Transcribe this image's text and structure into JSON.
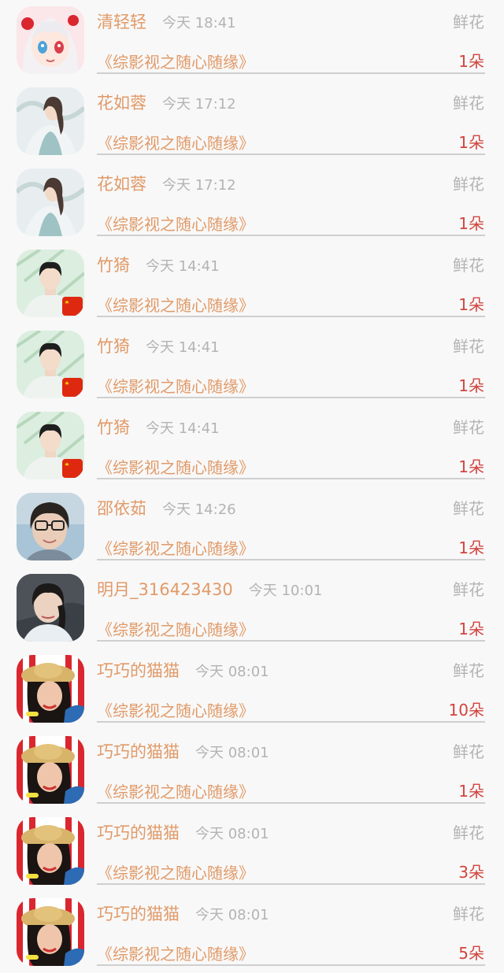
{
  "rows": [
    {
      "name": "清轻轻",
      "time": "今天 18:41",
      "gift": "鲜花",
      "book": "《综影视之随心随缘》",
      "count": "1朵",
      "avatar": "anime-girl"
    },
    {
      "name": "花如蓉",
      "time": "今天 17:12",
      "gift": "鲜花",
      "book": "《综影视之随心随缘》",
      "count": "1朵",
      "avatar": "hanfu-girl"
    },
    {
      "name": "花如蓉",
      "time": "今天 17:12",
      "gift": "鲜花",
      "book": "《综影视之随心随缘》",
      "count": "1朵",
      "avatar": "hanfu-girl"
    },
    {
      "name": "竹猗",
      "time": "今天 14:41",
      "gift": "鲜花",
      "book": "《综影视之随心随缘》",
      "count": "1朵",
      "avatar": "young-man-flag"
    },
    {
      "name": "竹猗",
      "time": "今天 14:41",
      "gift": "鲜花",
      "book": "《综影视之随心随缘》",
      "count": "1朵",
      "avatar": "young-man-flag"
    },
    {
      "name": "竹猗",
      "time": "今天 14:41",
      "gift": "鲜花",
      "book": "《综影视之随心随缘》",
      "count": "1朵",
      "avatar": "young-man-flag"
    },
    {
      "name": "邵依茹",
      "time": "今天 14:26",
      "gift": "鲜花",
      "book": "《综影视之随心随缘》",
      "count": "1朵",
      "avatar": "glasses-girl"
    },
    {
      "name": "明月_316423430",
      "time": "今天 10:01",
      "gift": "鲜花",
      "book": "《综影视之随心随缘》",
      "count": "1朵",
      "avatar": "braid-girl"
    },
    {
      "name": "巧巧的猫猫",
      "time": "今天 08:01",
      "gift": "鲜花",
      "book": "《综影视之随心随缘》",
      "count": "10朵",
      "avatar": "hat-woman"
    },
    {
      "name": "巧巧的猫猫",
      "time": "今天 08:01",
      "gift": "鲜花",
      "book": "《综影视之随心随缘》",
      "count": "1朵",
      "avatar": "hat-woman"
    },
    {
      "name": "巧巧的猫猫",
      "time": "今天 08:01",
      "gift": "鲜花",
      "book": "《综影视之随心随缘》",
      "count": "3朵",
      "avatar": "hat-woman"
    },
    {
      "name": "巧巧的猫猫",
      "time": "今天 08:01",
      "gift": "鲜花",
      "book": "《综影视之随心随缘》",
      "count": "5朵",
      "avatar": "hat-woman"
    }
  ]
}
